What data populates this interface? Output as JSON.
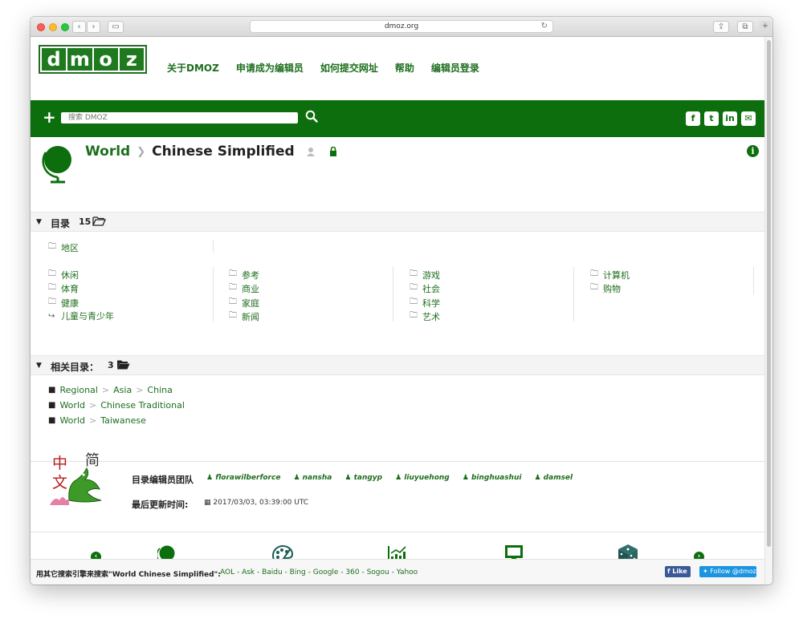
{
  "browser": {
    "url": "dmoz.org"
  },
  "logo": {
    "letters": [
      "d",
      "m",
      "o",
      "z"
    ]
  },
  "topnav": [
    "关于DMOZ",
    "申请成为编辑员",
    "如何提交网址",
    "帮助",
    "编辑员登录"
  ],
  "search": {
    "placeholder": "搜索 DMOZ"
  },
  "social": [
    "f",
    "t",
    "in",
    "✉"
  ],
  "breadcrumb": {
    "parent": "World",
    "current": "Chinese Simplified"
  },
  "categories_section": {
    "label": "目录",
    "count": "15",
    "region": "地区",
    "columns": [
      [
        "休闲",
        "体育",
        "健康",
        "儿童与青少年"
      ],
      [
        "参考",
        "商业",
        "家庭",
        "新闻"
      ],
      [
        "游戏",
        "社会",
        "科学",
        "艺术"
      ],
      [
        "计算机",
        "购物"
      ]
    ]
  },
  "related_section": {
    "label": "相关目录：",
    "count": "3",
    "items": [
      [
        "Regional",
        "Asia",
        "China"
      ],
      [
        "World",
        "Chinese Traditional"
      ],
      [
        "World",
        "Taiwanese"
      ]
    ]
  },
  "editors": {
    "team_label": "目录编辑员团队",
    "names": [
      "florawilberforce",
      "nansha",
      "tangyp",
      "liuyuehong",
      "binghuashui",
      "damsel"
    ],
    "updated_label": "最后更新时间:",
    "updated_value": "2017/03/03, 03:39:00 UTC"
  },
  "footer": {
    "search_elsewhere": "用其它搜索引擎来搜索\"World Chinese Simplified\":",
    "engines": "AOL - Ask - Baidu - Bing - Google - 360 - Sogou - Yahoo",
    "like_label": "Like",
    "follow_label": "Follow @dmoz"
  },
  "colors": {
    "brand_green": "#0c6e0c",
    "link_green": "#1e6e1e"
  }
}
